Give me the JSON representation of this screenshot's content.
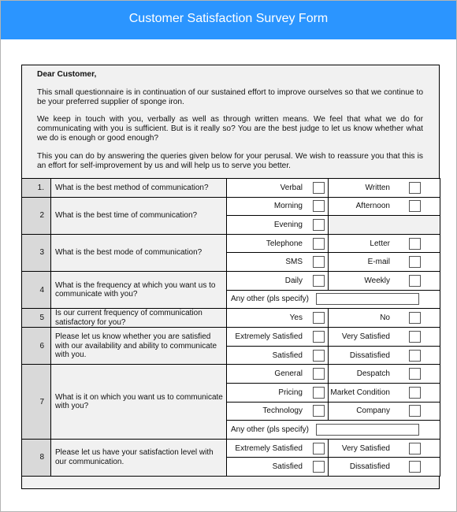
{
  "header": {
    "title": "Customer Satisfaction Survey Form"
  },
  "intro": {
    "greeting": "Dear Customer,",
    "paragraphs": [
      "This small questionnaire is in continuation of our sustained effort to improve ourselves so that we continue to be your preferred supplier of sponge iron.",
      "We keep in touch with you, verbally as well as through written means. We feel that what we do for communicating with you is sufficient. But is it really so? You are the best judge to let us know whether what we do is enough or good enough?",
      "This you can do by answering the queries given below for your perusal. We wish to reassure you that this is an effort for self-improvement by us and will help us to serve you better."
    ]
  },
  "questions": [
    {
      "number": "1.",
      "text": "What is the best method of communication?",
      "options": [
        "Verbal",
        "Written"
      ]
    },
    {
      "number": "2",
      "text": "What is the best time of communication?",
      "options": [
        "Morning",
        "Afternoon",
        "Evening"
      ]
    },
    {
      "number": "3",
      "text": "What is the best mode of communication?",
      "options": [
        "Telephone",
        "Letter",
        "SMS",
        "E-mail"
      ]
    },
    {
      "number": "4",
      "text": "What is the frequency at which you want us to communicate with you?",
      "options": [
        "Daily",
        "Weekly"
      ],
      "other_label": "Any other (pls specify)",
      "other_value": ""
    },
    {
      "number": "5",
      "text": "Is our current frequency of communication satisfactory for you?",
      "options": [
        "Yes",
        "No"
      ]
    },
    {
      "number": "6",
      "text": "Please let us know whether you are satisfied with our availability and ability to communicate with you.",
      "options": [
        "Extremely Satisfied",
        "Very Satisfied",
        "Satisfied",
        "Dissatisfied"
      ]
    },
    {
      "number": "7",
      "text": "What is it on which you want us to communicate with you?",
      "options": [
        "General",
        "Despatch",
        "Pricing",
        "Market Condition",
        "Technology",
        "Company"
      ],
      "other_label": "Any other (pls specify)",
      "other_value": ""
    },
    {
      "number": "8",
      "text": "Please let us have your satisfaction level with our communication.",
      "options": [
        "Extremely Satisfied",
        "Very Satisfied",
        "Satisfied",
        "Dissatisfied"
      ]
    }
  ]
}
